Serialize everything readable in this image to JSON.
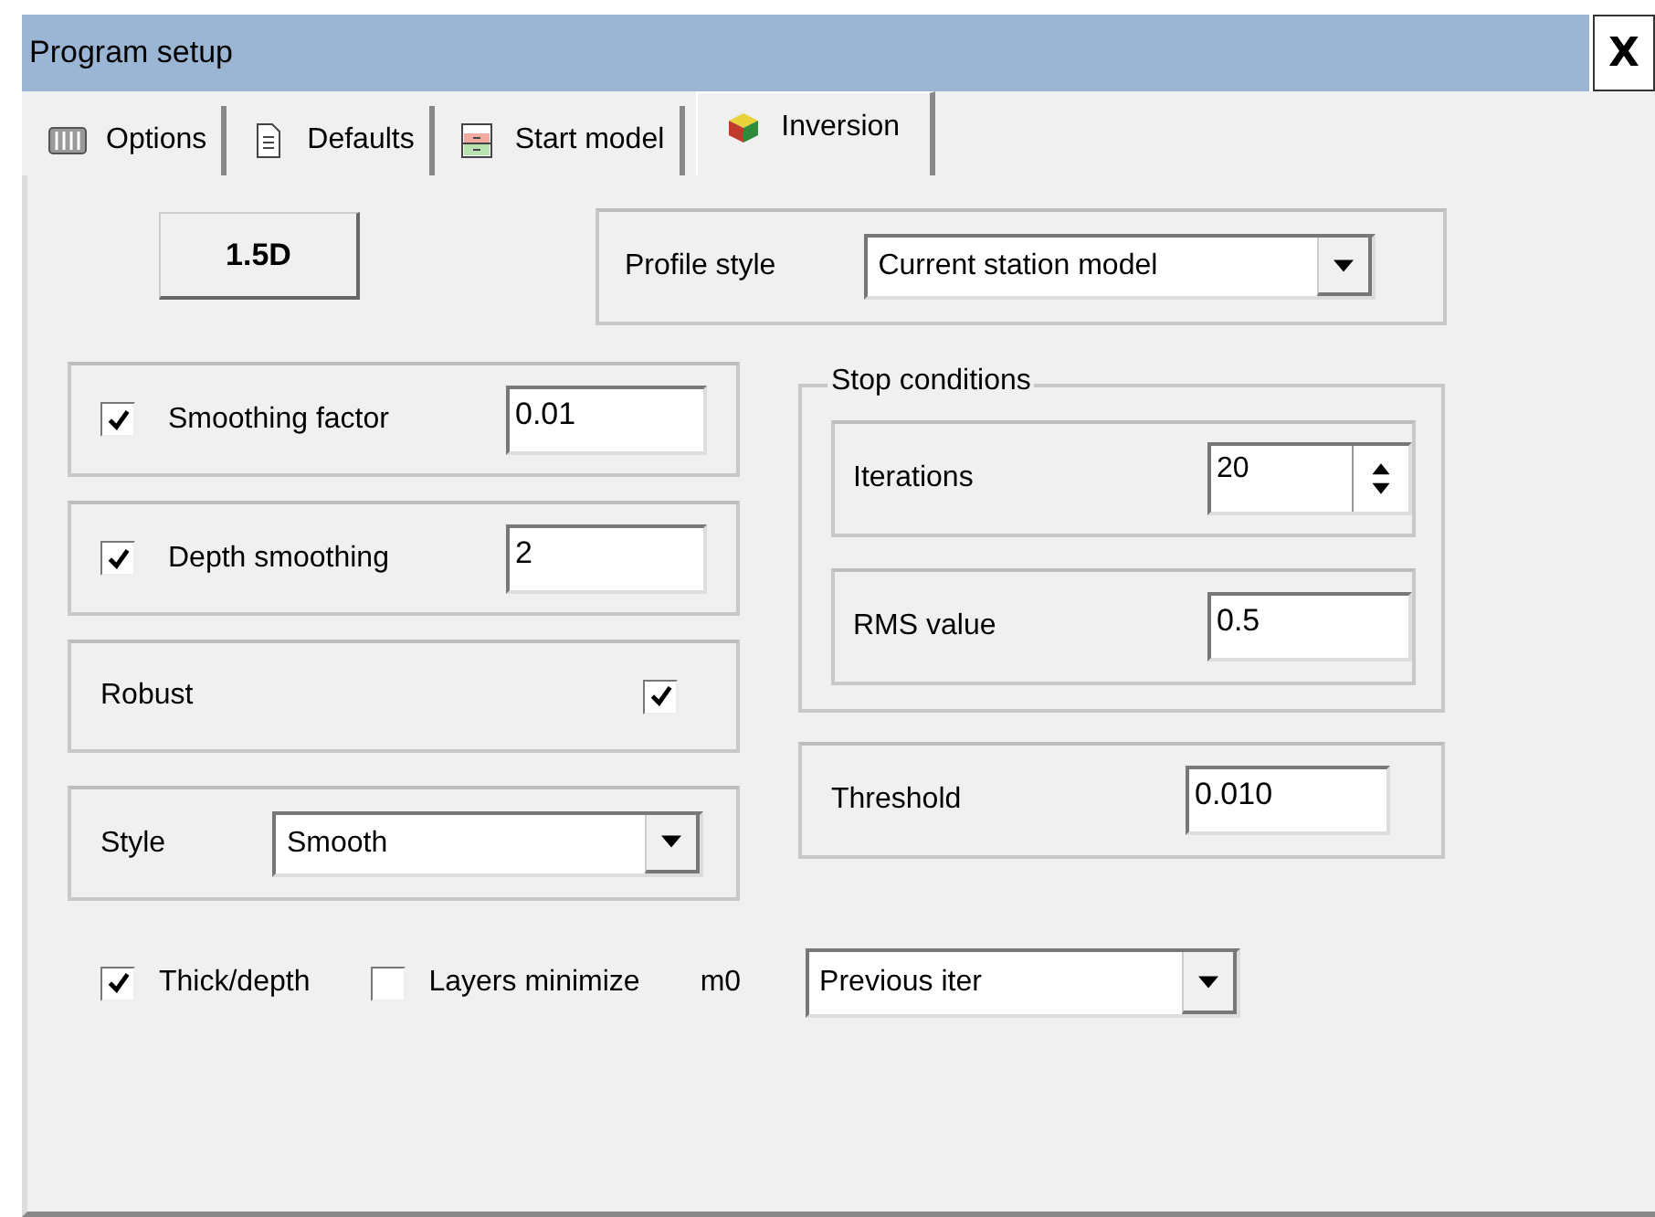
{
  "window": {
    "title": "Program setup",
    "close": "X"
  },
  "tabs": [
    {
      "label": "Options",
      "selected": false
    },
    {
      "label": "Defaults",
      "selected": false
    },
    {
      "label": "Start model",
      "selected": false
    },
    {
      "label": "Inversion",
      "selected": true
    }
  ],
  "mode_button": "1.5D",
  "profile_style": {
    "label": "Profile style",
    "value": "Current station model"
  },
  "smoothing_factor": {
    "label": "Smoothing factor",
    "checked": true,
    "value": "0.01"
  },
  "depth_smoothing": {
    "label": "Depth smoothing",
    "checked": true,
    "value": "2"
  },
  "robust": {
    "label": "Robust",
    "checked": true
  },
  "style": {
    "label": "Style",
    "value": "Smooth"
  },
  "stop_conditions": {
    "title": "Stop conditions",
    "iterations": {
      "label": "Iterations",
      "value": "20"
    },
    "rms": {
      "label": "RMS value",
      "value": "0.5"
    }
  },
  "threshold": {
    "label": "Threshold",
    "value": "0.010"
  },
  "thick_depth": {
    "label": "Thick/depth",
    "checked": true
  },
  "layers_minimize": {
    "label": "Layers minimize",
    "checked": false
  },
  "m0": {
    "label": "m0",
    "value": "Previous iter"
  }
}
